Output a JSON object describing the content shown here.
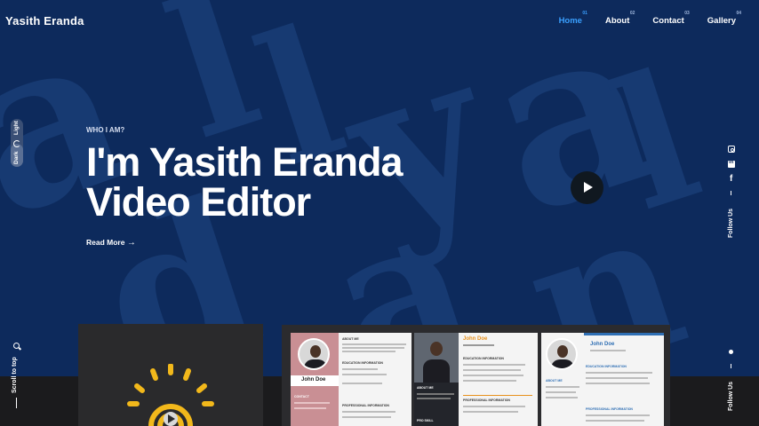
{
  "header": {
    "brand": "Yasith Eranda",
    "nav": [
      {
        "num": "01",
        "label": "Home",
        "active": true
      },
      {
        "num": "02",
        "label": "About"
      },
      {
        "num": "03",
        "label": "Contact"
      },
      {
        "num": "04",
        "label": "Gallery"
      }
    ]
  },
  "theme_toggle": {
    "light_label": "Light",
    "dark_label": "Dark"
  },
  "hero": {
    "eyebrow": "WHO I AM?",
    "line1": "I'm Yasith Eranda",
    "line2": "Video Editor",
    "read_more": "Read More"
  },
  "social": {
    "icons": [
      "instagram-icon",
      "linkedin-icon",
      "facebook-icon"
    ],
    "follow_label": "Follow Us"
  },
  "scroll_top_label": "Scroll to top",
  "resumes": [
    {
      "name": "John Doe",
      "accent": "#c98f94",
      "sections": [
        "ABOUT ME",
        "EDUCATION INFORMATION",
        "CONTACT",
        "PROFESSIONAL INFORMATION"
      ]
    },
    {
      "name": "John Doe",
      "accent": "#e8921e",
      "sections": [
        "ABOUT ME",
        "EDUCATION INFORMATION",
        "PROFESSIONAL INFORMATION",
        "PRO SKILL"
      ]
    },
    {
      "name": "John Doe",
      "accent": "#2f6fb4",
      "sections": [
        "EDUCATION INFORMATION",
        "ABOUT ME",
        "PROFESSIONAL INFORMATION"
      ]
    }
  ],
  "colors": {
    "background": "#0d2a5c",
    "accent": "#3aa0ff",
    "dark_band": "#1b1b1d",
    "logo_yellow": "#f2b81b"
  }
}
